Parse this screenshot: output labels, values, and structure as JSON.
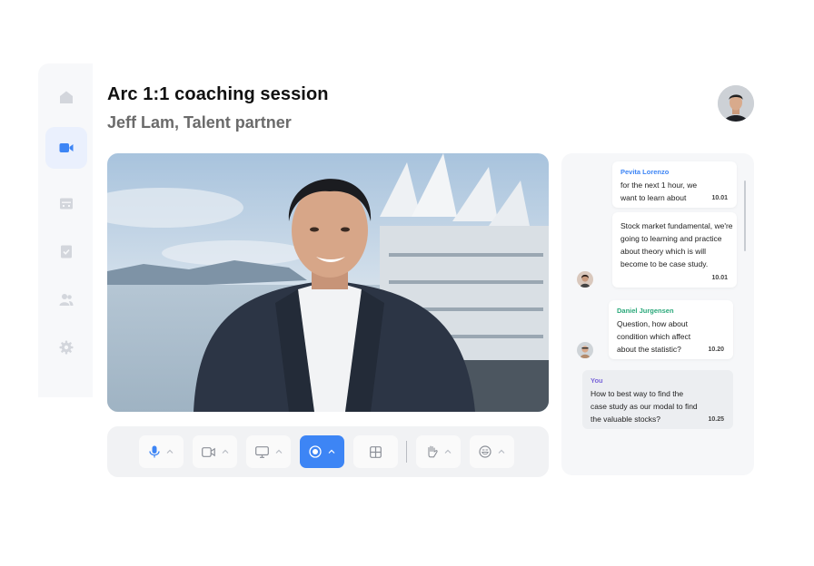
{
  "app": {
    "title": "Arc 1:1 coaching session",
    "subtitle": "Jeff Lam, Talent partner"
  },
  "sidebar": {
    "items": [
      {
        "icon": "home-icon",
        "active": false
      },
      {
        "icon": "video-camera-icon",
        "active": true
      },
      {
        "icon": "calendar-icon",
        "active": false
      },
      {
        "icon": "clipboard-check-icon",
        "active": false
      },
      {
        "icon": "users-icon",
        "active": false
      },
      {
        "icon": "gear-icon",
        "active": false
      }
    ]
  },
  "controls": {
    "items": [
      {
        "icon": "microphone-icon",
        "has_menu": true
      },
      {
        "icon": "video-camera-icon",
        "has_menu": true
      },
      {
        "icon": "screen-share-icon",
        "has_menu": true
      },
      {
        "icon": "record-icon",
        "has_menu": true,
        "active": true
      },
      {
        "icon": "grid-layout-icon",
        "has_menu": false
      },
      {
        "icon": "raise-hand-icon",
        "has_menu": true
      },
      {
        "icon": "emoji-icon",
        "has_menu": true
      }
    ]
  },
  "chat": {
    "messages": [
      {
        "sender": "Pevita Lorenzo",
        "sender_color": "#3d85f5",
        "text": "for the next 1 hour, we want to learn about",
        "time": "10.01"
      },
      {
        "sender": "",
        "text": "Stock market fundamental, we're going to learning and practice about theory which is will become to be case study.",
        "time": "10.01"
      },
      {
        "sender": "Daniel Jurgensen",
        "sender_color": "#2aa87a",
        "text": "Question, how about condition which affect about the statistic?",
        "time": "10.20"
      },
      {
        "sender": "You",
        "sender_color": "#7a66d9",
        "text": "How to best way to find the case study as our modal to find the valuable stocks?",
        "time": "10.25"
      }
    ]
  },
  "colors": {
    "accent": "#3d85f5",
    "sidebar_bg": "#f7f8fa",
    "icon_muted": "#d3d6dc"
  }
}
